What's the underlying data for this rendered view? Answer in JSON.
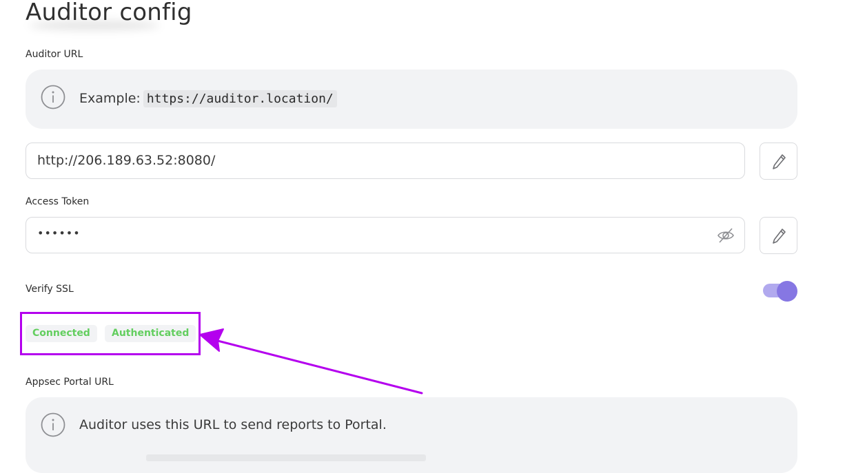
{
  "page": {
    "title": "Auditor config"
  },
  "auditor_url": {
    "label": "Auditor URL",
    "info_prefix": "Example:",
    "info_example": "https://auditor.location/",
    "value": "http://206.189.63.52:8080/"
  },
  "access_token": {
    "label": "Access Token",
    "value": "••••••",
    "visibility_icon": "eye-off-icon"
  },
  "verify_ssl": {
    "label": "Verify SSL",
    "enabled": true
  },
  "status": {
    "badges": [
      "Connected",
      "Authenticated"
    ],
    "color": "#63ce5f"
  },
  "appsec_portal_url": {
    "label": "Appsec Portal URL",
    "info_text": "Auditor uses this URL to send reports to Portal."
  },
  "colors": {
    "accent": "#8677e3",
    "annotation": "#b400ee",
    "success": "#63ce5f"
  }
}
